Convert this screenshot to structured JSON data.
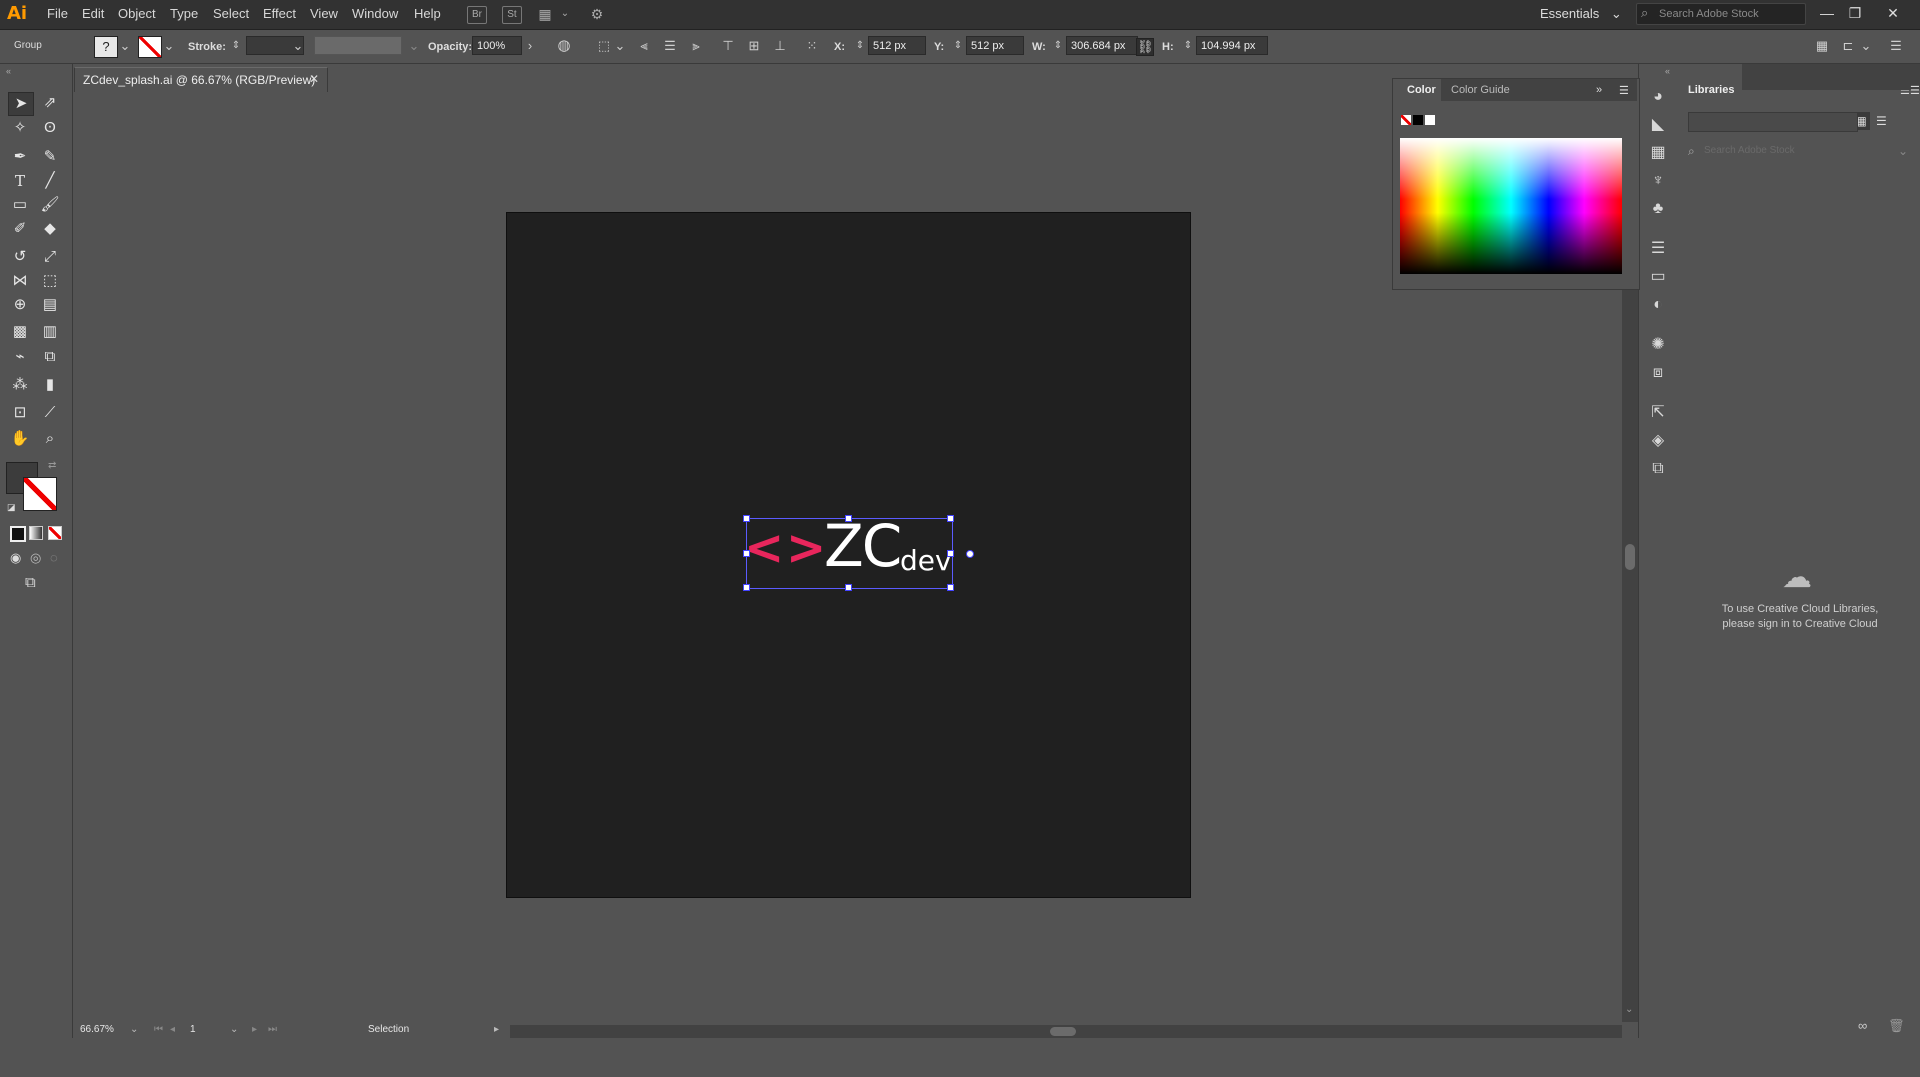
{
  "app": {
    "logo": "Ai",
    "accent": "#ff9a00"
  },
  "menu": [
    "File",
    "Edit",
    "Object",
    "Type",
    "Select",
    "Effect",
    "View",
    "Window",
    "Help"
  ],
  "menubar_icons": {
    "br": "Br",
    "st": "St"
  },
  "workspace": {
    "label": "Essentials",
    "chevron": "⌄"
  },
  "stock_search": {
    "placeholder": "Search Adobe Stock"
  },
  "window_controls": {
    "minimize": "—",
    "restore": "❐",
    "close": "✕"
  },
  "control_bar": {
    "selection_label": "Group",
    "fill_glyph": "?",
    "stroke_label": "Stroke:",
    "opacity_label": "Opacity:",
    "opacity_value": "100%",
    "x_label": "X:",
    "x_value": "512 px",
    "y_label": "Y:",
    "y_value": "512 px",
    "w_label": "W:",
    "w_value": "306.684 px",
    "h_label": "H:",
    "h_value": "104.994 px"
  },
  "document_tab": {
    "title": "ZCdev_splash.ai @ 66.67% (RGB/Preview)",
    "close": "✕"
  },
  "artwork": {
    "chevron_left": "<",
    "chevron_right": ">",
    "main_text": "ZC",
    "sub_text": "dev",
    "chevron_color": "#e8265c",
    "artboard_color": "#202020"
  },
  "status_bar": {
    "zoom": "66.67%",
    "artboard_number": "1",
    "tool": "Selection"
  },
  "color_panel": {
    "tab_color": "Color",
    "tab_guide": "Color Guide"
  },
  "libraries_panel": {
    "tab": "Libraries",
    "search_placeholder": "Search Adobe Stock",
    "message": "To use Creative Cloud Libraries, please sign in to Creative Cloud"
  }
}
